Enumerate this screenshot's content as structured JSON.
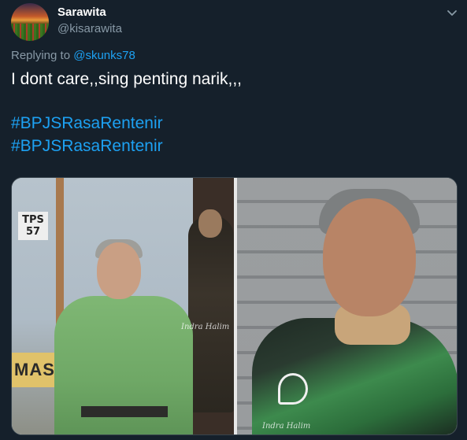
{
  "user": {
    "display_name": "Sarawita",
    "handle": "@kisarawita"
  },
  "reply": {
    "prefix": "Replying to ",
    "mention": "@skunks78"
  },
  "tweet": {
    "text": "I dont care,,sing penting narik,,,",
    "hashtags": [
      "#BPJSRasaRentenir",
      "#BPJSRasaRentenir"
    ]
  },
  "media": {
    "left_photo": {
      "sign_text": "TPS\n57",
      "banner_text": "MASU",
      "watermark": "Indra Halim"
    },
    "right_photo": {
      "watermark": "Indra Halim"
    }
  },
  "icons": {
    "menu": "chevron-down-icon"
  },
  "colors": {
    "background": "#15202b",
    "link": "#1da1f2",
    "secondary_text": "#8899a6"
  }
}
